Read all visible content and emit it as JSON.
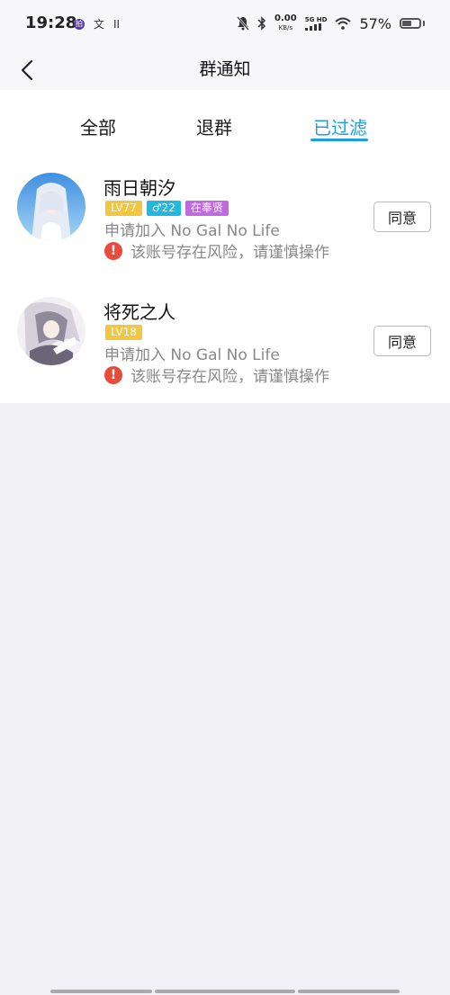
{
  "status_bar": {
    "time": "19:28",
    "app_icon_label": "拍",
    "lang_icon": "文",
    "pause_icon": "II",
    "net_speed_value": "0.00",
    "net_speed_unit": "KB/s",
    "signal_label": "5G HD",
    "battery_percent": "57%",
    "battery_level": 0.57
  },
  "nav": {
    "title": "群通知"
  },
  "tabs": [
    {
      "label": "全部",
      "active": false
    },
    {
      "label": "退群",
      "active": false
    },
    {
      "label": "已过滤",
      "active": true
    }
  ],
  "requests": [
    {
      "name": "雨日朝汐",
      "badges": {
        "level": "LV77",
        "gender_age": "♂22",
        "location": "在奉贤"
      },
      "apply_text": "申请加入 No Gal No Life",
      "warning": "该账号存在风险，请谨慎操作",
      "action_label": "同意"
    },
    {
      "name": "将死之人",
      "badges": {
        "level": "LV18"
      },
      "apply_text": "申请加入 No Gal No Life",
      "warning": "该账号存在风险，请谨慎操作",
      "action_label": "同意"
    }
  ],
  "colors": {
    "accent": "#1aa0e0",
    "warning": "#e84a3c",
    "level_badge": "#f3c63f",
    "gender_badge": "#1fb8e0",
    "location_badge": "#c06ae0"
  }
}
